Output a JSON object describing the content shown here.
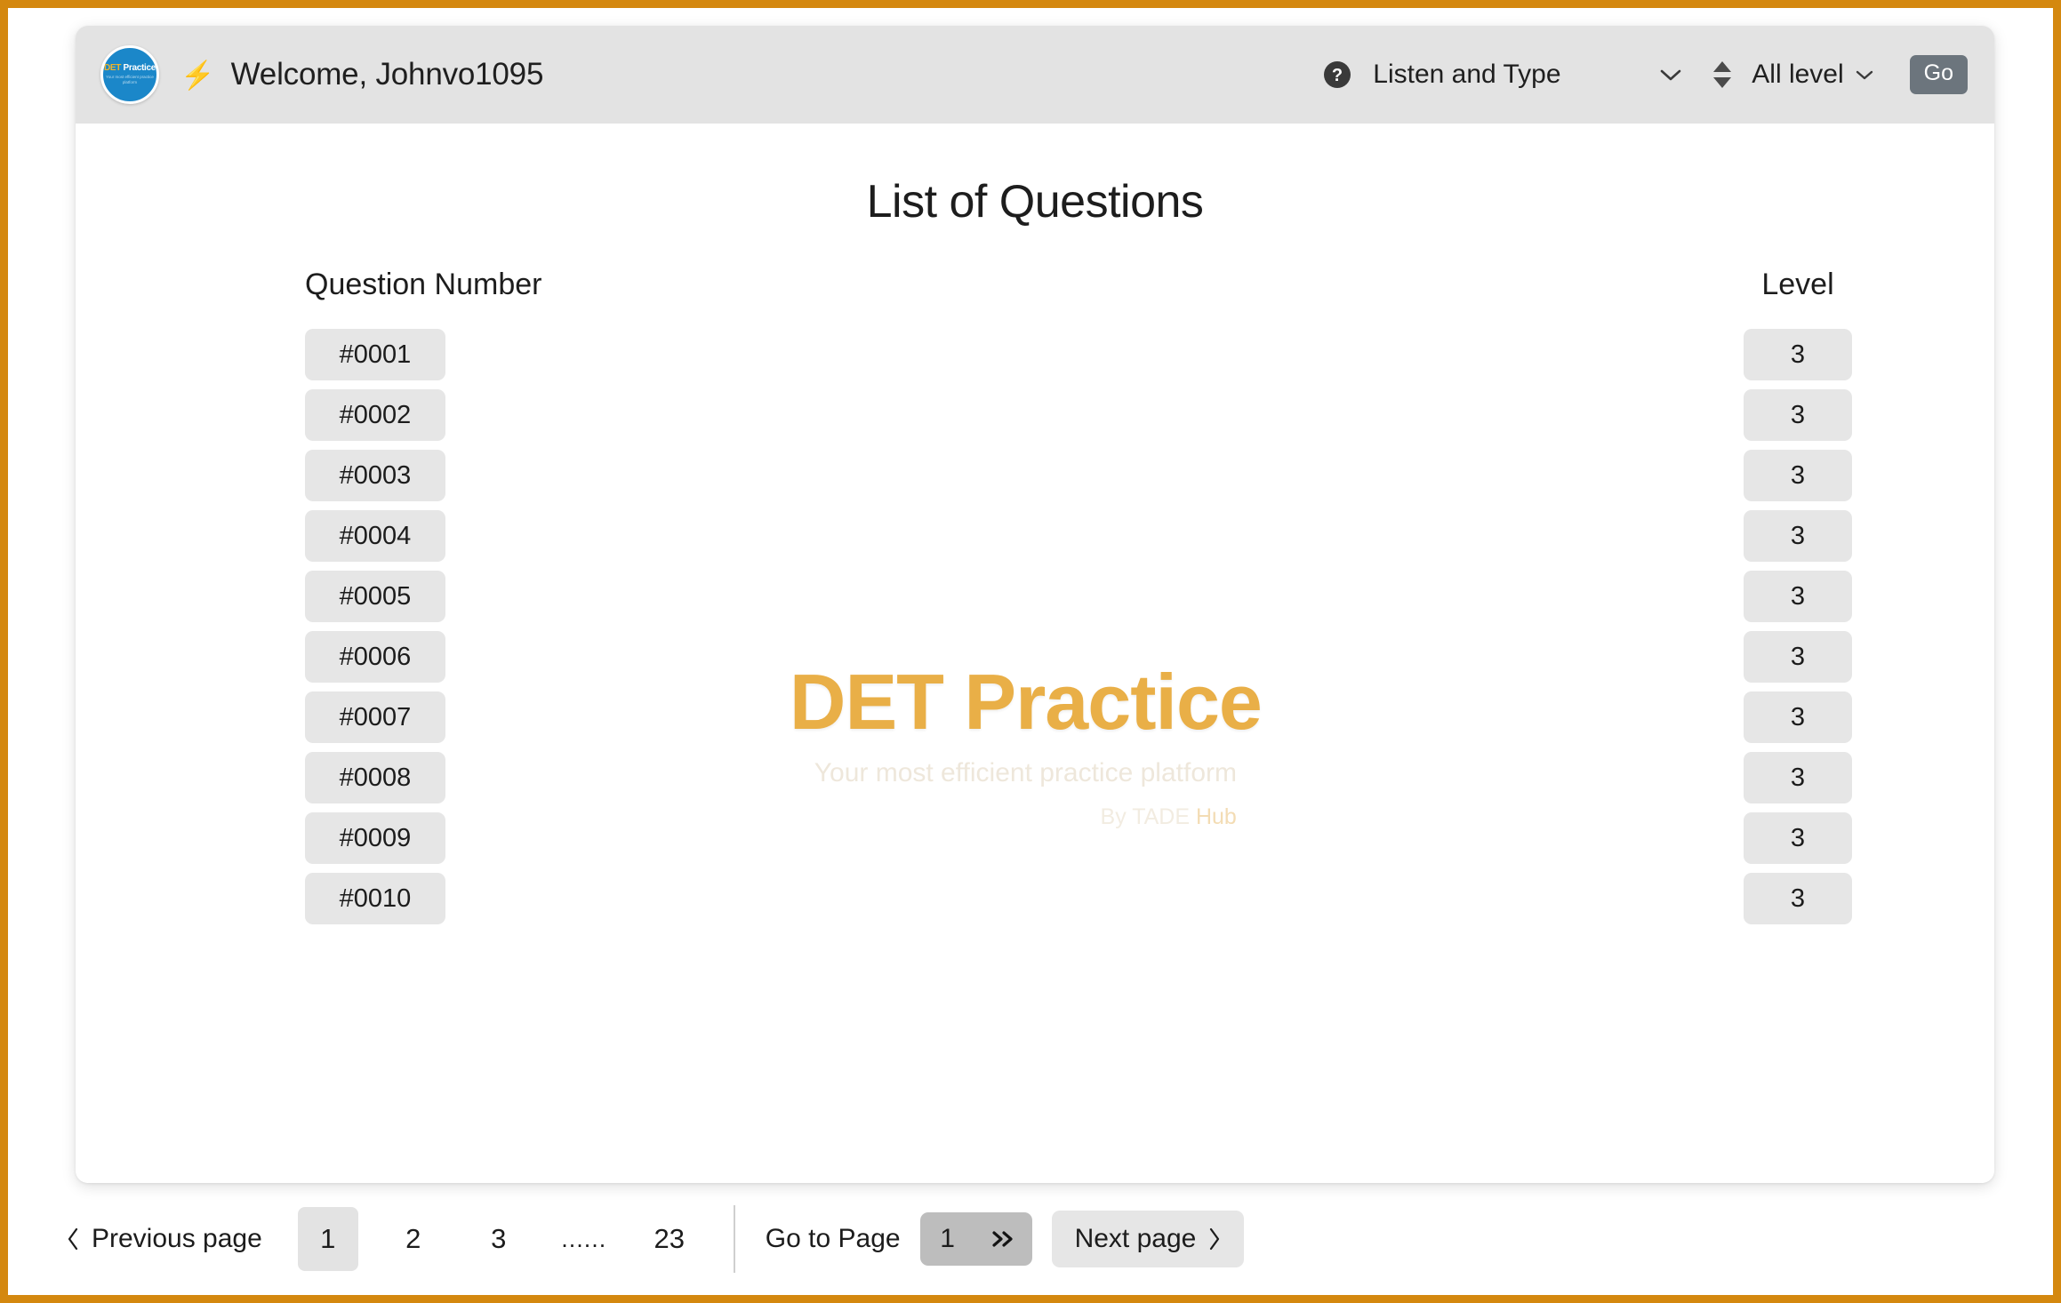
{
  "header": {
    "logo_alt": "DET Practice",
    "logo_line1_a": "DET",
    "logo_line1_b": " Practice",
    "logo_line2": "Your most efficient practice platform",
    "bolt": "⚡",
    "welcome": "Welcome, Johnvo1095",
    "help_icon": "help-circle-icon",
    "type_filter": "Listen and Type",
    "sort_icon": "sort-updown-icon",
    "level_filter": "All level",
    "go_label": "Go"
  },
  "main": {
    "title": "List of Questions",
    "columns": {
      "question_number": "Question Number",
      "level": "Level"
    },
    "rows": [
      {
        "question": "#0001",
        "level": "3"
      },
      {
        "question": "#0002",
        "level": "3"
      },
      {
        "question": "#0003",
        "level": "3"
      },
      {
        "question": "#0004",
        "level": "3"
      },
      {
        "question": "#0005",
        "level": "3"
      },
      {
        "question": "#0006",
        "level": "3"
      },
      {
        "question": "#0007",
        "level": "3"
      },
      {
        "question": "#0008",
        "level": "3"
      },
      {
        "question": "#0009",
        "level": "3"
      },
      {
        "question": "#0010",
        "level": "3"
      }
    ]
  },
  "watermark": {
    "title_bold": "DET",
    "title_thin": " Practice",
    "subtitle": "Your most efficient practice platform",
    "by_prefix": "By TADE ",
    "by_hub": "Hub"
  },
  "pagination": {
    "previous_label": "Previous page",
    "pages": [
      "1",
      "2",
      "3",
      "......",
      "23"
    ],
    "active_page": "1",
    "goto_label": "Go to Page",
    "goto_value": "1",
    "goto_placeholder": "1",
    "next_label": "Next page"
  },
  "colors": {
    "frame_border": "#d4880f",
    "header_bar": "#e3e3e3",
    "cell_bg": "#e6e6e6",
    "go_button": "#6c757d",
    "watermark_gold": "#e8a93a",
    "avatar_blue": "#1b87c9"
  }
}
